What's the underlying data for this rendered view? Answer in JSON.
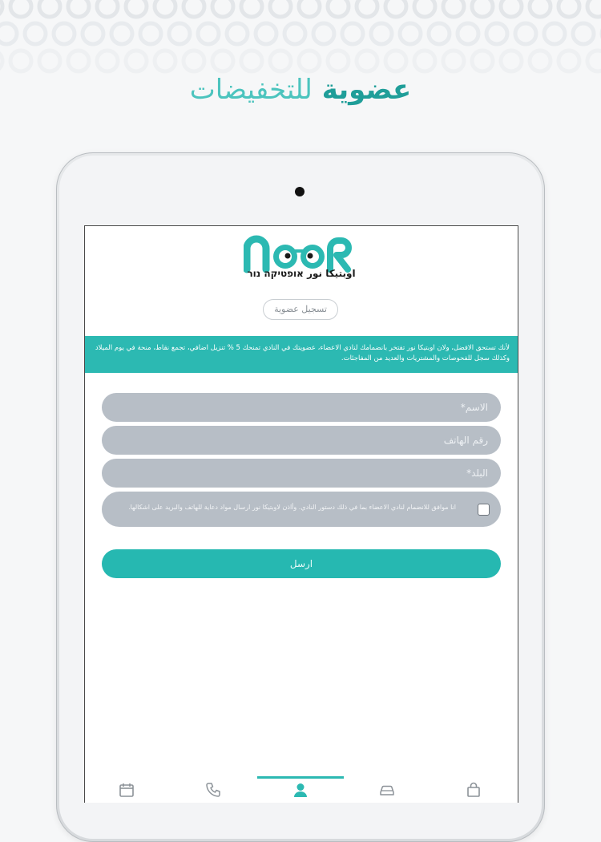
{
  "headline": {
    "strong": "عضوية",
    "light": "للتخفيضات"
  },
  "logo": {
    "wordmark": "NOOR",
    "subtitle": "اوبتيكا نور  אופטיקה נור"
  },
  "tabs": {
    "register": "تسجيل عضوية"
  },
  "banner": {
    "text": "لأنك تستحق الافضل، ولان اوبتيكا نور تفتخر بانضمامك لنادي الاعضاء، عضويتك في النادي تمنحك 5 % تنزيل اضافي، تجمع نقاط، منحة في يوم الميلاد وكذلك سجل للفحوصات والمشتريات والعديد من المفاجئات."
  },
  "form": {
    "name_placeholder": "الاسم*",
    "phone_placeholder": "رقم الهاتف",
    "city_placeholder": "البلد*",
    "consent_text": "انا موافق للانضمام لنادي الاعضاء بما في ذلك دستور النادي. وأاذن لاوبتيكا نور ارسال مواد دعاية للهاتف والبريد على اشكالها.",
    "submit_label": "ارسل"
  },
  "bottom_nav": [
    {
      "icon": "calendar-icon"
    },
    {
      "icon": "phone-icon"
    },
    {
      "icon": "user-icon",
      "active": true
    },
    {
      "icon": "car-icon"
    },
    {
      "icon": "shopping-bag-icon"
    }
  ],
  "colors": {
    "accent": "#2cb9b2",
    "field_bg": "#b7bec6",
    "page_bg": "#f6f7f8"
  }
}
